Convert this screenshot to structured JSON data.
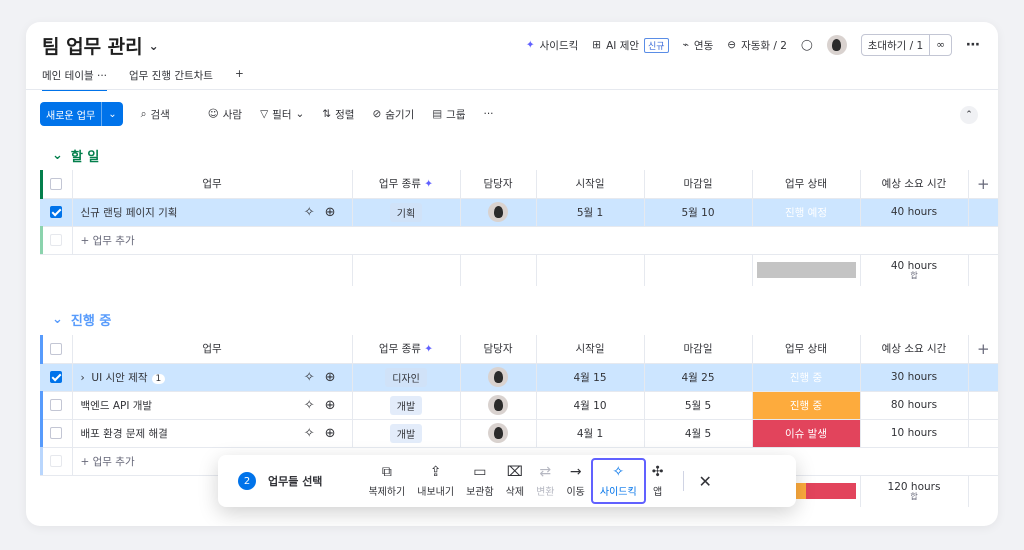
{
  "board": {
    "title": "팀 업무 관리"
  },
  "header": {
    "sidekick": "사이드킥",
    "ai": "AI 제안",
    "ai_badge": "신규",
    "integrate": "연동",
    "automate": "자동화 / 2",
    "invite": "초대하기 / 1"
  },
  "tabs": [
    {
      "label": "메인 테이블"
    },
    {
      "label": "업무 진행 간트차트"
    }
  ],
  "tabs_more": "···",
  "tabs_add": "+",
  "toolbar": {
    "new_item": "새로운 업무",
    "search": "검색",
    "person": "사람",
    "filter": "필터",
    "sort": "정렬",
    "hide": "숨기기",
    "group": "그룹",
    "more": "···"
  },
  "columns": {
    "task": "업무",
    "type": "업무 종류",
    "owner": "담당자",
    "start": "시작일",
    "due": "마감일",
    "status": "업무 상태",
    "time": "예상 소요 시간"
  },
  "add_item": "+ 업무 추가",
  "groups": [
    {
      "title": "할 일",
      "color": "#037f4c",
      "rows": [
        {
          "task": "신규 랜딩 페이지 기획",
          "type": "기획",
          "start": "5월 1",
          "due": "5월 10",
          "status": "진행 예정",
          "time": "40 hours"
        }
      ],
      "sum": {
        "time": "40 hours",
        "sub": "합"
      }
    },
    {
      "title": "진행 중",
      "color": "#579bfc",
      "rows": [
        {
          "task": "UI 시안 제작",
          "count": "1",
          "type": "디자인",
          "start": "4월 15",
          "due": "4월 25",
          "status": "진행 중",
          "time": "30 hours"
        },
        {
          "task": "백엔드 API 개발",
          "type": "개발",
          "start": "4월 10",
          "due": "5월 5",
          "status": "진행 중",
          "time": "80 hours"
        },
        {
          "task": "배포 환경 문제 해결",
          "type": "개발",
          "start": "4월 1",
          "due": "4월 5",
          "status": "이슈 발생",
          "time": "10 hours"
        }
      ],
      "sum": {
        "time": "120 hours",
        "sub": "합"
      }
    }
  ],
  "action_bar": {
    "count": "2",
    "label": "업무들 선택",
    "duplicate": "복제하기",
    "export": "내보내기",
    "archive": "보관함",
    "delete": "삭제",
    "convert": "변환",
    "move": "이동",
    "sidekick": "사이드킥",
    "apps": "앱"
  }
}
